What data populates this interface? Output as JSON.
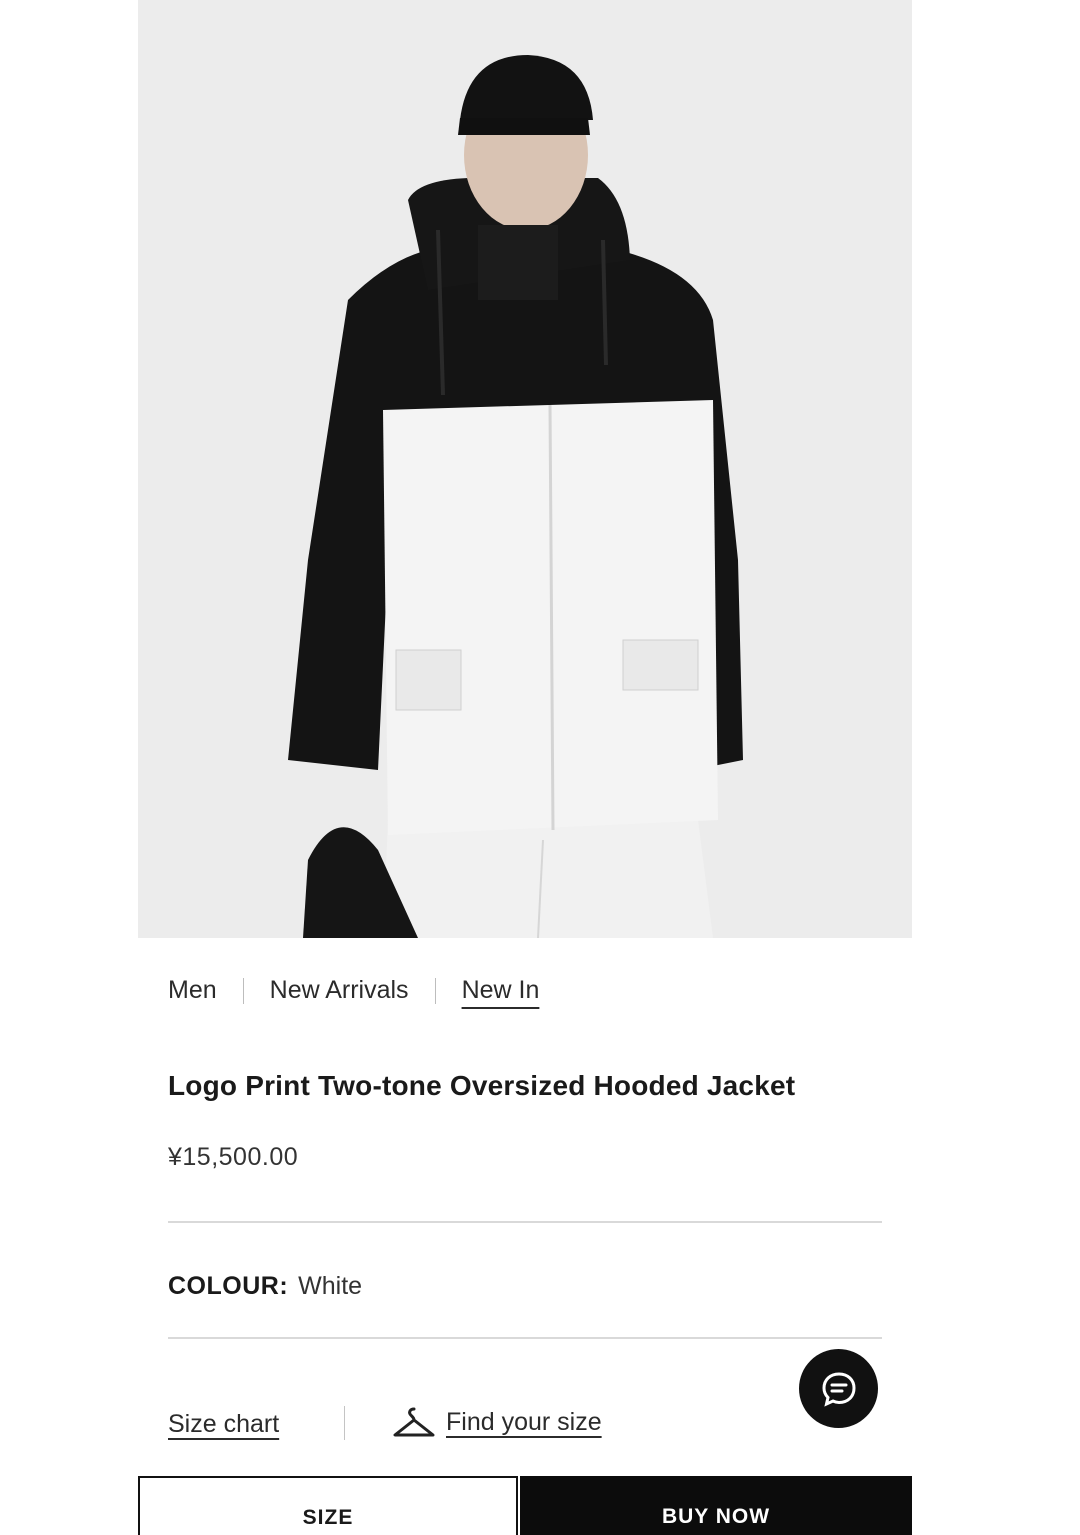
{
  "product": {
    "image_alt": "Model wearing two-tone oversized hooded jacket",
    "title": "Logo Print Two-tone Oversized Hooded Jacket",
    "price": "¥15,500.00"
  },
  "breadcrumb": [
    {
      "label": "Men"
    },
    {
      "label": "New Arrivals"
    },
    {
      "label": "New In"
    }
  ],
  "colour": {
    "label": "COLOUR:",
    "value": "White"
  },
  "size_links": {
    "size_chart": "Size chart",
    "find_size": "Find your size"
  },
  "actions": {
    "size": "SIZE",
    "buy_now": "BUY NOW"
  },
  "icons": {
    "chat": "chat-bubble-icon",
    "hanger": "hanger-icon"
  }
}
